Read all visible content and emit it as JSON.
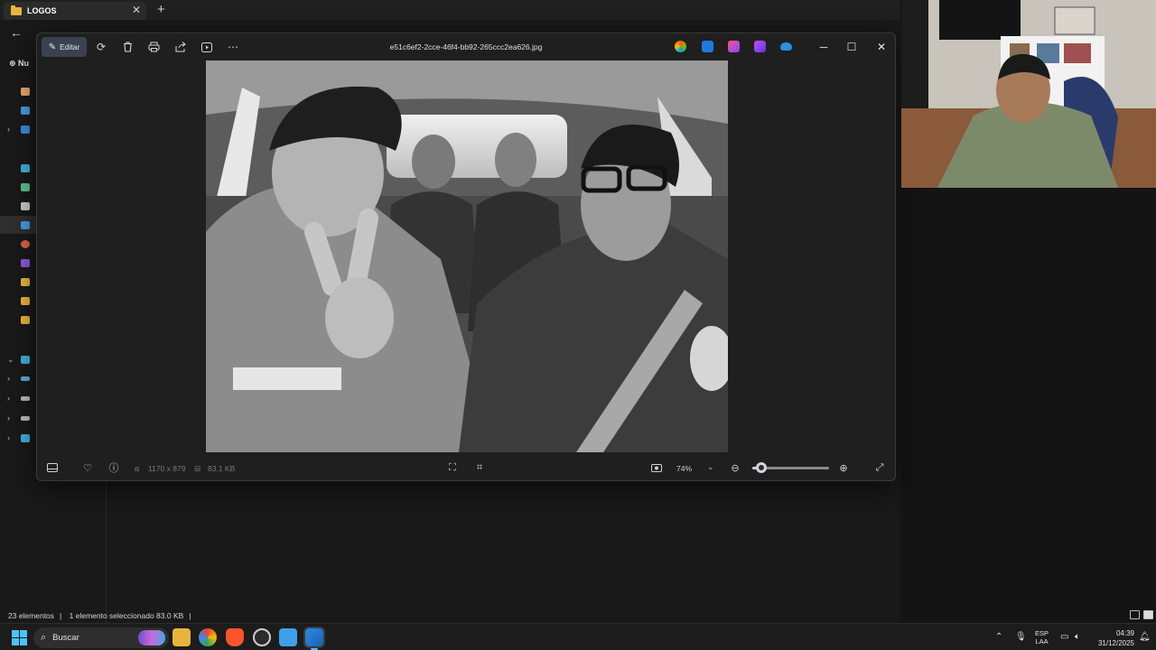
{
  "explorer": {
    "tab_title": "LOGOS",
    "new_button": "Nu",
    "status": {
      "count": "23 elementos",
      "selection": "1 elemento seleccionado  83.0 KB"
    }
  },
  "photos": {
    "edit_label": "Editar",
    "filename": "e51c6ef2-2cce-46f4-bb92-265ccc2ea626.jpg",
    "dimensions": "1170 x 879",
    "filesize": "83.1 KB",
    "zoom": "74%",
    "zoom_fraction": 0.12
  },
  "taskbar": {
    "search_placeholder": "Buscar",
    "lang_top": "ESP",
    "lang_bottom": "LAA",
    "time": "04:39",
    "date": "31/12/2025"
  },
  "colors": {
    "accent": "#4cc2ff",
    "folder": "#e8b53c"
  }
}
